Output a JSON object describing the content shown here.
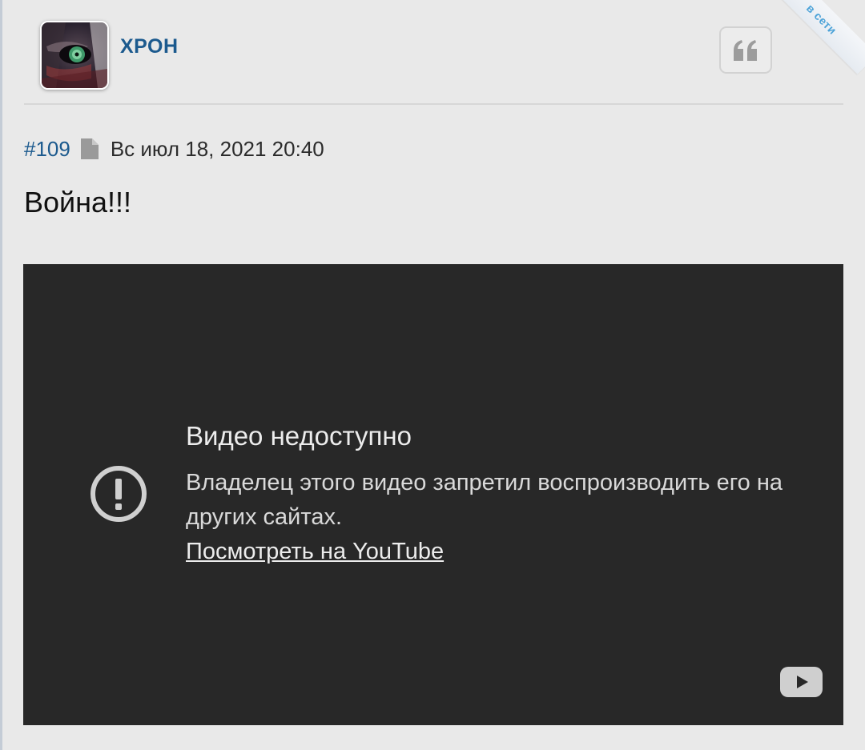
{
  "post": {
    "author": "ХРОН",
    "online_badge": "в сети",
    "number": "#109",
    "date": "Вс июл 18, 2021 20:40",
    "text": "Война!!!"
  },
  "video": {
    "error_title": "Видео недоступно",
    "error_message": "Владелец этого видео запретил воспроизводить его на других сайтах.",
    "watch_link": "Посмотреть на YouTube"
  },
  "colors": {
    "page_background": "#e9e9e9",
    "username": "#1c5a8e",
    "online_badge": "#4da3d8",
    "video_background": "#282828",
    "video_text": "#ececec"
  },
  "icons": {
    "quote": "quote-icon",
    "post_permalink": "document-icon",
    "video_error": "exclamation-circle-icon",
    "youtube": "youtube-logo-icon"
  }
}
